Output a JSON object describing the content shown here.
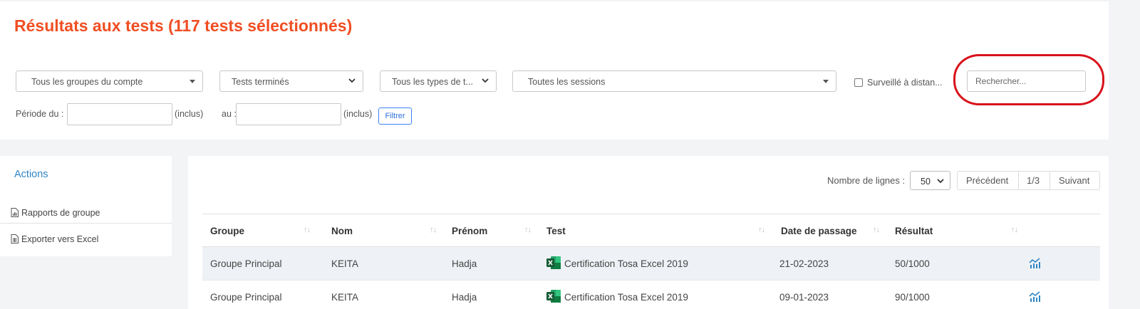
{
  "page": {
    "title": "Résultats aux tests (117 tests sélectionnés)"
  },
  "filters": {
    "group_select": "Tous les groupes du compte",
    "status_select": "Tests terminés",
    "type_select": "Tous les types de t...",
    "session_select": "Toutes les sessions",
    "remote_checkbox_label": "Surveillé à distan...",
    "remote_checked": false,
    "search_placeholder": "Rechercher...",
    "period_from_label": "Période du :",
    "period_from_value": "",
    "inclusive_label_1": "(inclus)",
    "period_to_label": "au :",
    "period_to_value": "",
    "inclusive_label_2": "(inclus)",
    "filter_button": "Filtrer"
  },
  "sidebar": {
    "title": "Actions",
    "items": [
      {
        "label": "Rapports de groupe",
        "icon": "chart-document-icon"
      },
      {
        "label": "Exporter vers Excel",
        "icon": "spreadsheet-document-icon"
      }
    ]
  },
  "table_controls": {
    "rows_label": "Nombre de lignes :",
    "rows_value": "50",
    "prev_label": "Précédent",
    "page_indicator": "1/3",
    "next_label": "Suivant"
  },
  "table": {
    "columns": [
      "Groupe",
      "Nom",
      "Prénom",
      "Test",
      "Date de passage",
      "Résultat"
    ],
    "sort_glyph": "↑↓",
    "rows": [
      {
        "groupe": "Groupe Principal",
        "nom": "KEITA",
        "prenom": "Hadja",
        "test": "Certification Tosa Excel 2019",
        "date": "21-02-2023",
        "resultat": "50/1000",
        "action_icon": "stats-chart-icon"
      },
      {
        "groupe": "Groupe Principal",
        "nom": "KEITA",
        "prenom": "Hadja",
        "test": "Certification Tosa Excel 2019",
        "date": "09-01-2023",
        "resultat": "90/1000",
        "action_icon": "stats-chart-icon"
      }
    ]
  },
  "colors": {
    "title": "#f04e23",
    "accent_blue": "#2f86c5",
    "highlight": "#d8121b",
    "excel_green": "#1e7145"
  }
}
